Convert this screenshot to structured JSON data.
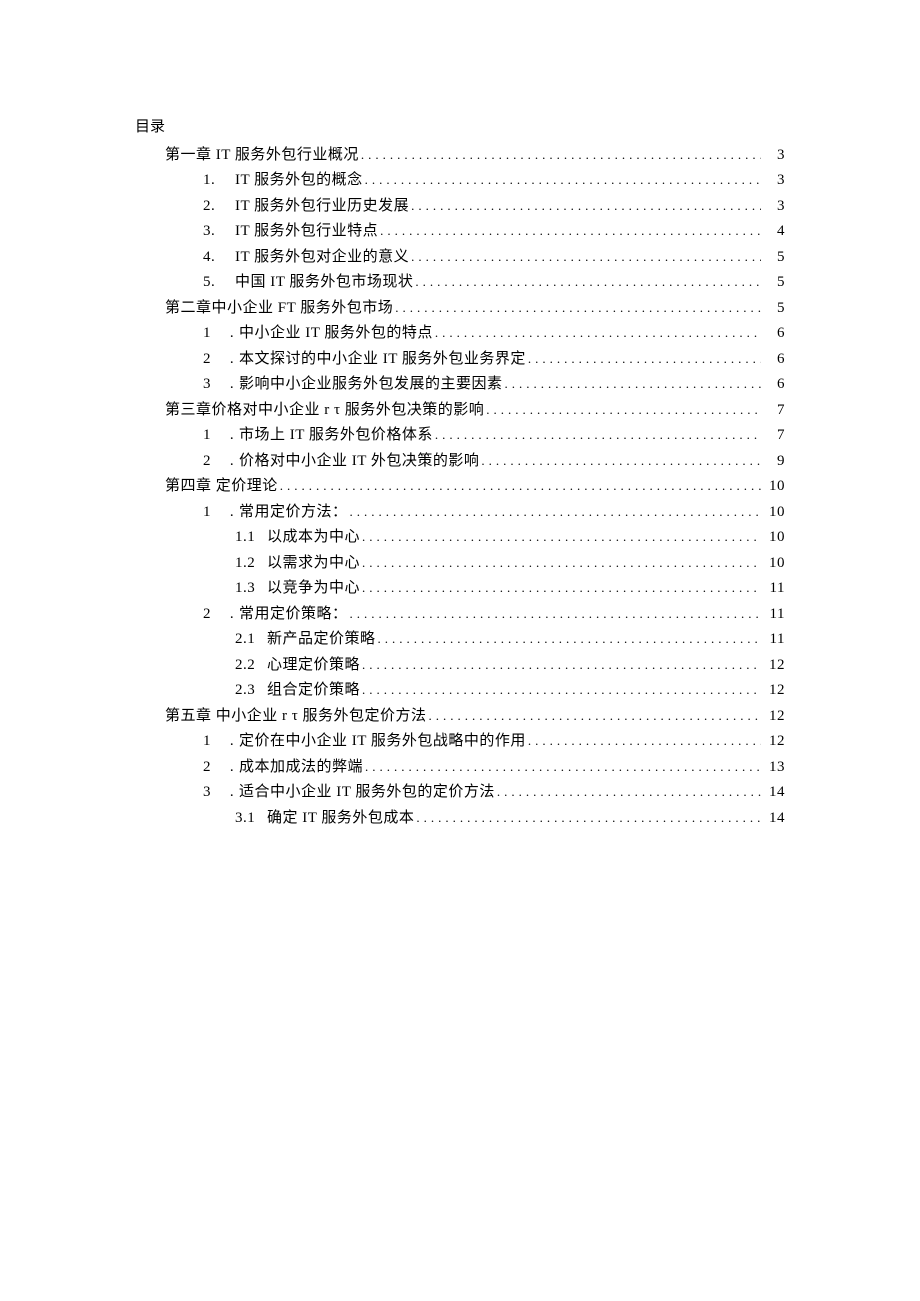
{
  "heading": "目录",
  "toc": [
    {
      "level": 1,
      "num": "",
      "sep": "",
      "title": "第一章 IT 服务外包行业概况",
      "page": "3"
    },
    {
      "level": 2,
      "num": "1.",
      "sep": "",
      "title": "IT 服务外包的概念",
      "page": "3"
    },
    {
      "level": 2,
      "num": "2.",
      "sep": "",
      "title": "IT 服务外包行业历史发展",
      "page": "3"
    },
    {
      "level": 2,
      "num": "3.",
      "sep": "",
      "title": "IT 服务外包行业特点",
      "page": "4"
    },
    {
      "level": 2,
      "num": "4.",
      "sep": "",
      "title": "IT 服务外包对企业的意义",
      "page": "5"
    },
    {
      "level": 2,
      "num": "5.",
      "sep": "",
      "title": "中国 IT 服务外包市场现状",
      "page": "5"
    },
    {
      "level": 1,
      "num": "",
      "sep": "",
      "title": "第二章中小企业 FT 服务外包市场",
      "page": "5"
    },
    {
      "level": 2,
      "num": "1",
      "sep": ".",
      "title": "中小企业 IT 服务外包的特点",
      "page": "6"
    },
    {
      "level": 2,
      "num": "2",
      "sep": ".",
      "title": "本文探讨的中小企业 IT 服务外包业务界定",
      "page": "6"
    },
    {
      "level": 2,
      "num": "3",
      "sep": ".",
      "title": "影响中小企业服务外包发展的主要因素",
      "page": "6"
    },
    {
      "level": 1,
      "num": "",
      "sep": "",
      "title": "第三章价格对中小企业 r τ 服务外包决策的影响",
      "page": "7"
    },
    {
      "level": 2,
      "num": "1",
      "sep": ".",
      "title": "市场上 IT 服务外包价格体系",
      "page": "7"
    },
    {
      "level": 2,
      "num": "2",
      "sep": ".",
      "title": "价格对中小企业 IT 外包决策的影响",
      "page": "9"
    },
    {
      "level": 1,
      "num": "",
      "sep": "",
      "title": "第四章   定价理论",
      "page": "10"
    },
    {
      "level": 2,
      "num": "1",
      "sep": ".",
      "title": "常用定价方法：",
      "page": "10"
    },
    {
      "level": 3,
      "num": "1.1",
      "sep": "",
      "title": "以成本为中心",
      "page": "10"
    },
    {
      "level": 3,
      "num": "1.2",
      "sep": "",
      "title": "以需求为中心",
      "page": "10"
    },
    {
      "level": 3,
      "num": "1.3",
      "sep": "",
      "title": "以竞争为中心",
      "page": "11"
    },
    {
      "level": 2,
      "num": "2",
      "sep": ".",
      "title": "常用定价策略：",
      "page": "11"
    },
    {
      "level": 3,
      "num": "2.1",
      "sep": "",
      "title": "新产品定价策略",
      "page": "11"
    },
    {
      "level": 3,
      "num": "2.2",
      "sep": "",
      "title": "心理定价策略",
      "page": "12"
    },
    {
      "level": 3,
      "num": "2.3",
      "sep": "",
      "title": "组合定价策略",
      "page": "12"
    },
    {
      "level": 1,
      "num": "",
      "sep": "",
      "title": "第五章   中小企业 r τ 服务外包定价方法",
      "page": "12"
    },
    {
      "level": 2,
      "num": "1",
      "sep": ".",
      "title": "定价在中小企业 IT 服务外包战略中的作用",
      "page": "12"
    },
    {
      "level": 2,
      "num": "2",
      "sep": ".",
      "title": "成本加成法的弊端",
      "page": "13"
    },
    {
      "level": 2,
      "num": "3",
      "sep": ".",
      "title": "适合中小企业 IT 服务外包的定价方法",
      "page": "14"
    },
    {
      "level": 3,
      "num": "3.1",
      "sep": "",
      "title": "确定 IT 服务外包成本",
      "page": "14"
    }
  ]
}
